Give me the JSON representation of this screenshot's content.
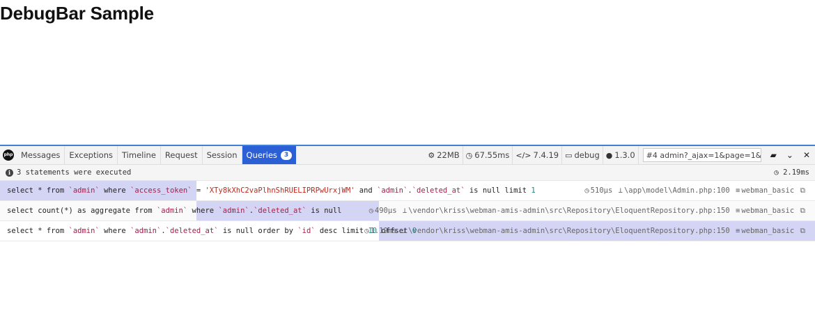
{
  "page": {
    "title": "DebugBar Sample"
  },
  "debugbar": {
    "logo_text": "php",
    "tabs": [
      {
        "label": "Messages"
      },
      {
        "label": "Exceptions"
      },
      {
        "label": "Timeline"
      },
      {
        "label": "Request"
      },
      {
        "label": "Session"
      },
      {
        "label": "Queries",
        "badge": "3",
        "active": true
      }
    ],
    "indicators": {
      "memory": "22MB",
      "time": "67.55ms",
      "php_version": "7.4.19",
      "env": "debug",
      "version": "1.3.0"
    },
    "request_select": {
      "value": "#4 admin?_ajax=1&page=1&pe"
    },
    "summary": {
      "text": "3 statements were executed",
      "duration": "2.19ms"
    },
    "queries": [
      {
        "sql_parts": [
          "select * from ",
          "`admin`",
          " where ",
          "`access_token`",
          " = ",
          "'XTy8kXhC2vaPlhnShRUELIPRPwUrxjWM'",
          " and ",
          "`admin`",
          ".",
          "`deleted_at`",
          " is null limit ",
          "1"
        ],
        "duration": "510μs",
        "source": "\\app\\model\\Admin.php:100",
        "connection": "webman_basic"
      },
      {
        "sql_parts": [
          "select count(*) as aggregate from ",
          "`admin`",
          " where ",
          "`admin`",
          ".",
          "`deleted_at`",
          " is null"
        ],
        "duration": "490μs",
        "source": "\\vendor\\kriss\\webman-amis-admin\\src\\Repository\\EloquentRepository.php:150",
        "connection": "webman_basic"
      },
      {
        "sql_parts": [
          "select * from ",
          "`admin`",
          " where ",
          "`admin`",
          ".",
          "`deleted_at`",
          " is null order by ",
          "`id`",
          " desc limit ",
          "10",
          " offset ",
          "0"
        ],
        "duration": "1.19ms",
        "source": "\\vendor\\kriss\\webman-amis-admin\\src\\Repository\\EloquentRepository.php:150",
        "connection": "webman_basic"
      }
    ]
  }
}
